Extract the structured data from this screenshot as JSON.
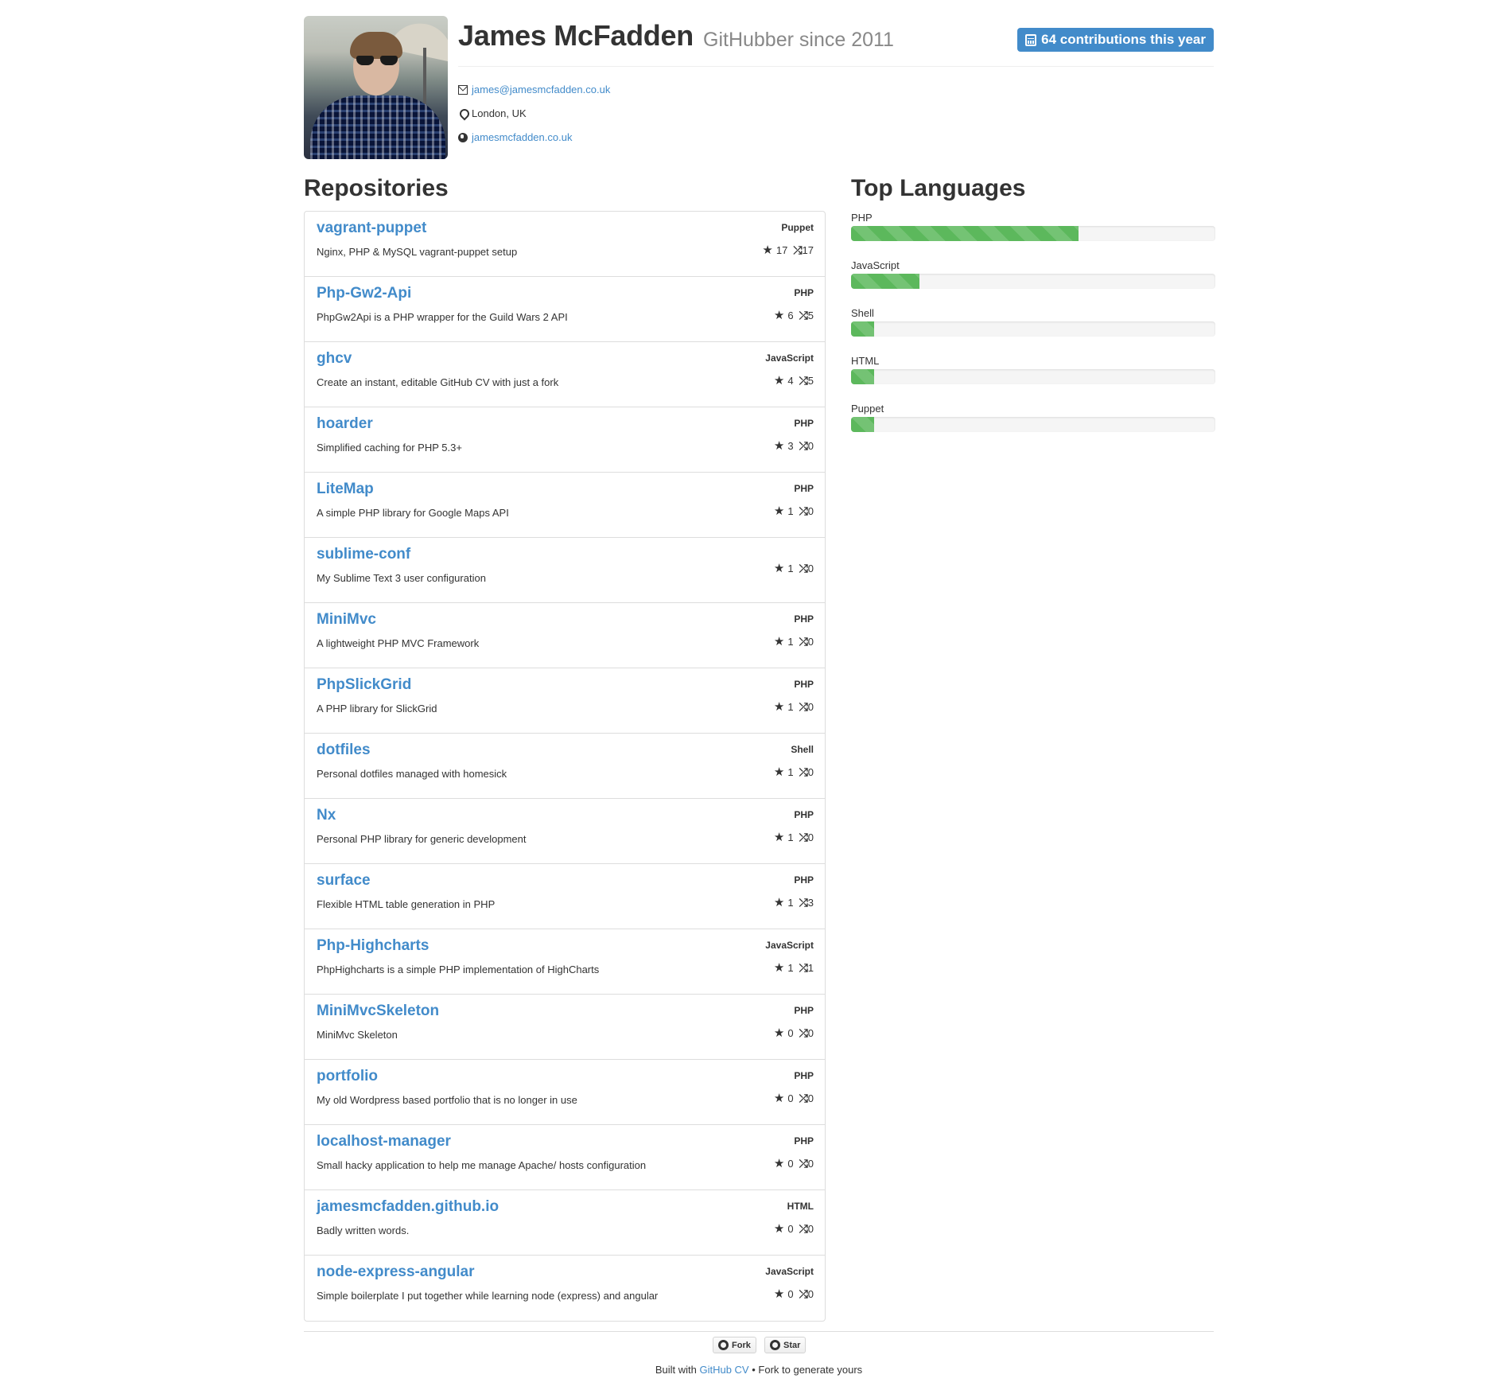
{
  "profile": {
    "name": "James McFadden",
    "since": "GitHubber since 2011",
    "contributions": "64 contributions this year",
    "email": "james@jamesmcfadden.co.uk",
    "location": "London, UK",
    "website": "jamesmcfadden.co.uk"
  },
  "repositories": {
    "heading": "Repositories",
    "items": [
      {
        "name": "vagrant-puppet",
        "description": "Nginx, PHP & MySQL vagrant-puppet setup",
        "language": "Puppet",
        "stars": "17",
        "forks": "17"
      },
      {
        "name": "Php-Gw2-Api",
        "description": "PhpGw2Api is a PHP wrapper for the Guild Wars 2 API",
        "language": "PHP",
        "stars": "6",
        "forks": "5"
      },
      {
        "name": "ghcv",
        "description": "Create an instant, editable GitHub CV with just a fork",
        "language": "JavaScript",
        "stars": "4",
        "forks": "5"
      },
      {
        "name": "hoarder",
        "description": "Simplified caching for PHP 5.3+",
        "language": "PHP",
        "stars": "3",
        "forks": "0"
      },
      {
        "name": "LiteMap",
        "description": "A simple PHP library for Google Maps API",
        "language": "PHP",
        "stars": "1",
        "forks": "0"
      },
      {
        "name": "sublime-conf",
        "description": "My Sublime Text 3 user configuration",
        "language": "",
        "stars": "1",
        "forks": "0"
      },
      {
        "name": "MiniMvc",
        "description": "A lightweight PHP MVC Framework",
        "language": "PHP",
        "stars": "1",
        "forks": "0"
      },
      {
        "name": "PhpSlickGrid",
        "description": "A PHP library for SlickGrid",
        "language": "PHP",
        "stars": "1",
        "forks": "0"
      },
      {
        "name": "dotfiles",
        "description": "Personal dotfiles managed with homesick",
        "language": "Shell",
        "stars": "1",
        "forks": "0"
      },
      {
        "name": "Nx",
        "description": "Personal PHP library for generic development",
        "language": "PHP",
        "stars": "1",
        "forks": "0"
      },
      {
        "name": "surface",
        "description": "Flexible HTML table generation in PHP",
        "language": "PHP",
        "stars": "1",
        "forks": "3"
      },
      {
        "name": "Php-Highcharts",
        "description": "PhpHighcharts is a simple PHP implementation of HighCharts",
        "language": "JavaScript",
        "stars": "1",
        "forks": "1"
      },
      {
        "name": "MiniMvcSkeleton",
        "description": "MiniMvc Skeleton",
        "language": "PHP",
        "stars": "0",
        "forks": "0"
      },
      {
        "name": "portfolio",
        "description": "My old Wordpress based portfolio that is no longer in use",
        "language": "PHP",
        "stars": "0",
        "forks": "0"
      },
      {
        "name": "localhost-manager",
        "description": "Small hacky application to help me manage Apache/ hosts configuration",
        "language": "PHP",
        "stars": "0",
        "forks": "0"
      },
      {
        "name": "jamesmcfadden.github.io",
        "description": "Badly written words.",
        "language": "HTML",
        "stars": "0",
        "forks": "0"
      },
      {
        "name": "node-express-angular",
        "description": "Simple boilerplate I put together while learning node (express) and angular",
        "language": "JavaScript",
        "stars": "0",
        "forks": "0"
      }
    ]
  },
  "languages": {
    "heading": "Top Languages",
    "items": [
      {
        "name": "PHP",
        "percent": 62.5
      },
      {
        "name": "JavaScript",
        "percent": 18.8
      },
      {
        "name": "Shell",
        "percent": 6.3
      },
      {
        "name": "HTML",
        "percent": 6.3
      },
      {
        "name": "Puppet",
        "percent": 6.3
      }
    ],
    "bar_color": "#5cb85c"
  },
  "footer": {
    "fork_label": "Fork",
    "star_label": "Star",
    "built_with": "Built with",
    "github_cv": "GitHub CV",
    "tagline": "• Fork to generate yours"
  },
  "colors": {
    "link": "#428bca",
    "accent_badge": "#428bca",
    "muted": "#888888"
  },
  "icons": {
    "email": "envelope-icon",
    "location": "map-marker-icon",
    "website": "globe-icon",
    "contributions": "calendar-icon",
    "stars": "star-icon",
    "forks": "fork-icon"
  }
}
